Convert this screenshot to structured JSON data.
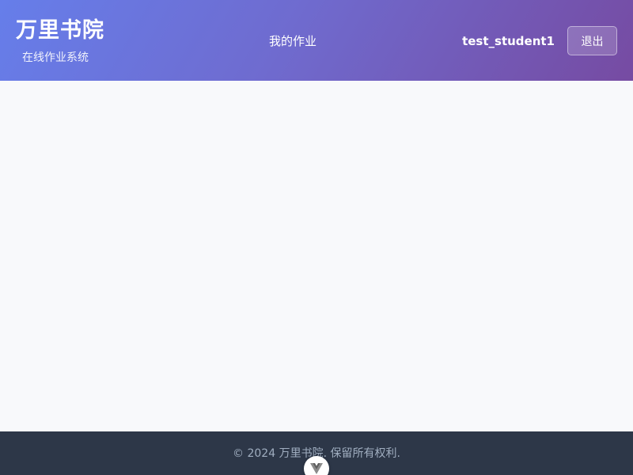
{
  "header": {
    "brand_title": "万里书院",
    "brand_subtitle": "在线作业系统",
    "nav_items": [
      {
        "label": "我的作业"
      }
    ],
    "username": "test_student1",
    "logout_label": "退出"
  },
  "footer": {
    "copyright": "© 2024 万里书院. 保留所有权利."
  },
  "icons": {
    "devtools_badge": "vue-logo-icon"
  },
  "colors": {
    "header_gradient_start": "#667eea",
    "header_gradient_end": "#764ba2",
    "page_background": "#f8f9fb",
    "footer_background": "#2d3748",
    "footer_text": "#a0aec0"
  }
}
